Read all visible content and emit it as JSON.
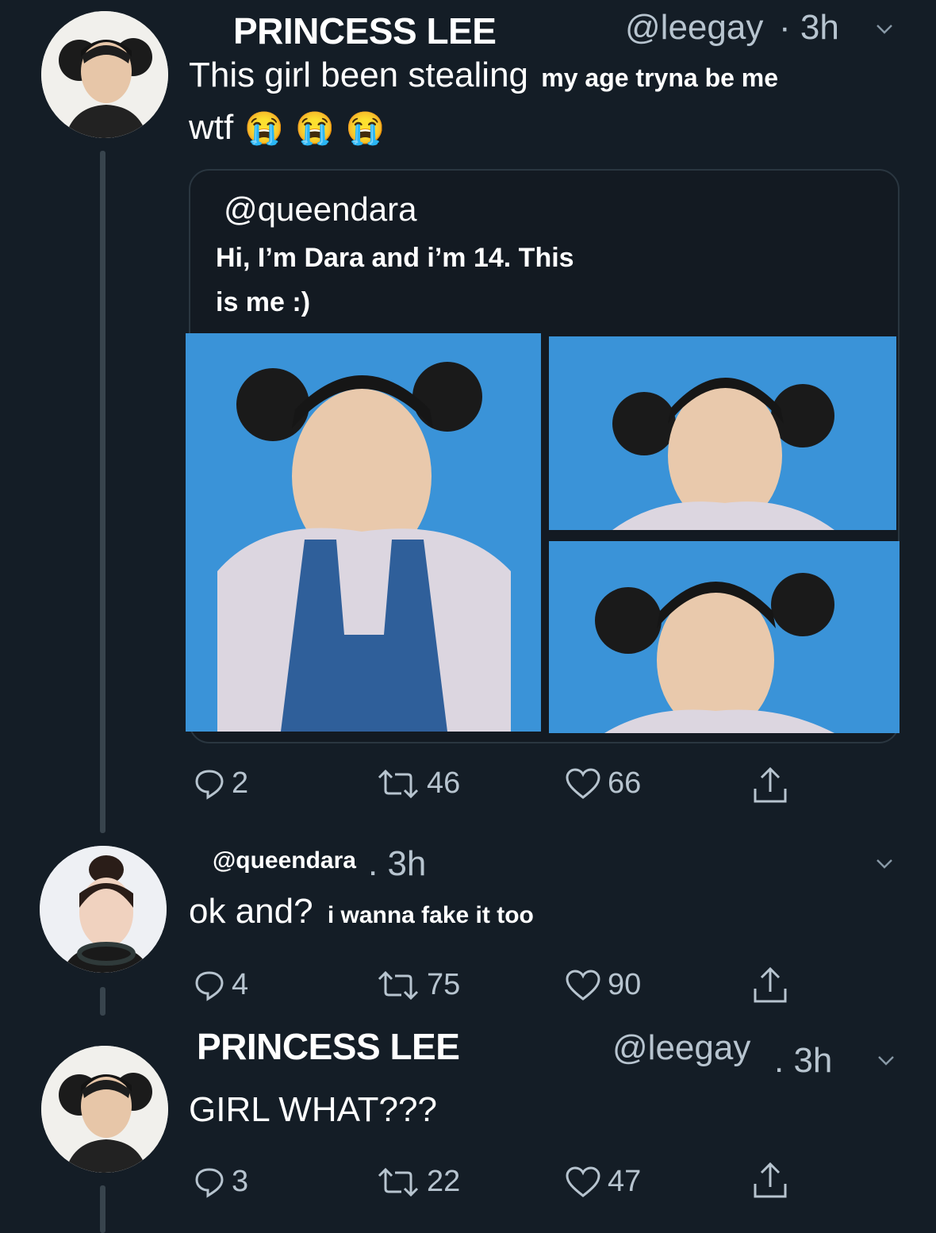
{
  "tweet1": {
    "name": "PRINCESS LEE",
    "handle": "@leegay",
    "time": "· 3h",
    "text_main": "This girl been stealing",
    "text_overlay": "my age tryna be me",
    "text_line2": "wtf",
    "emojis": [
      "😭",
      "😭",
      "😭"
    ],
    "quote": {
      "handle": "@queendara",
      "text_line1": "Hi, I’m Dara and i’m 14. This",
      "text_line2": "is me :)"
    },
    "actions": {
      "replies": "2",
      "retweets": "46",
      "likes": "66"
    }
  },
  "tweet2": {
    "handle": "@queendara",
    "time": ". 3h",
    "text_main": "ok and?",
    "text_overlay": "i wanna fake it too",
    "actions": {
      "replies": "4",
      "retweets": "75",
      "likes": "90"
    }
  },
  "tweet3": {
    "name": "PRINCESS LEE",
    "handle": "@leegay",
    "time": ". 3h",
    "text": "GIRL WHAT???",
    "actions": {
      "replies": "3",
      "retweets": "22",
      "likes": "47"
    }
  },
  "icons": {
    "reply": "speech-bubble-icon",
    "retweet": "retweet-arrows-icon",
    "like": "heart-icon",
    "share": "share-upload-icon",
    "more": "chevron-down-icon"
  },
  "colors": {
    "background": "#141d26",
    "secondary_text": "#b7c4cf",
    "photo_bg": "#3a93d8"
  }
}
